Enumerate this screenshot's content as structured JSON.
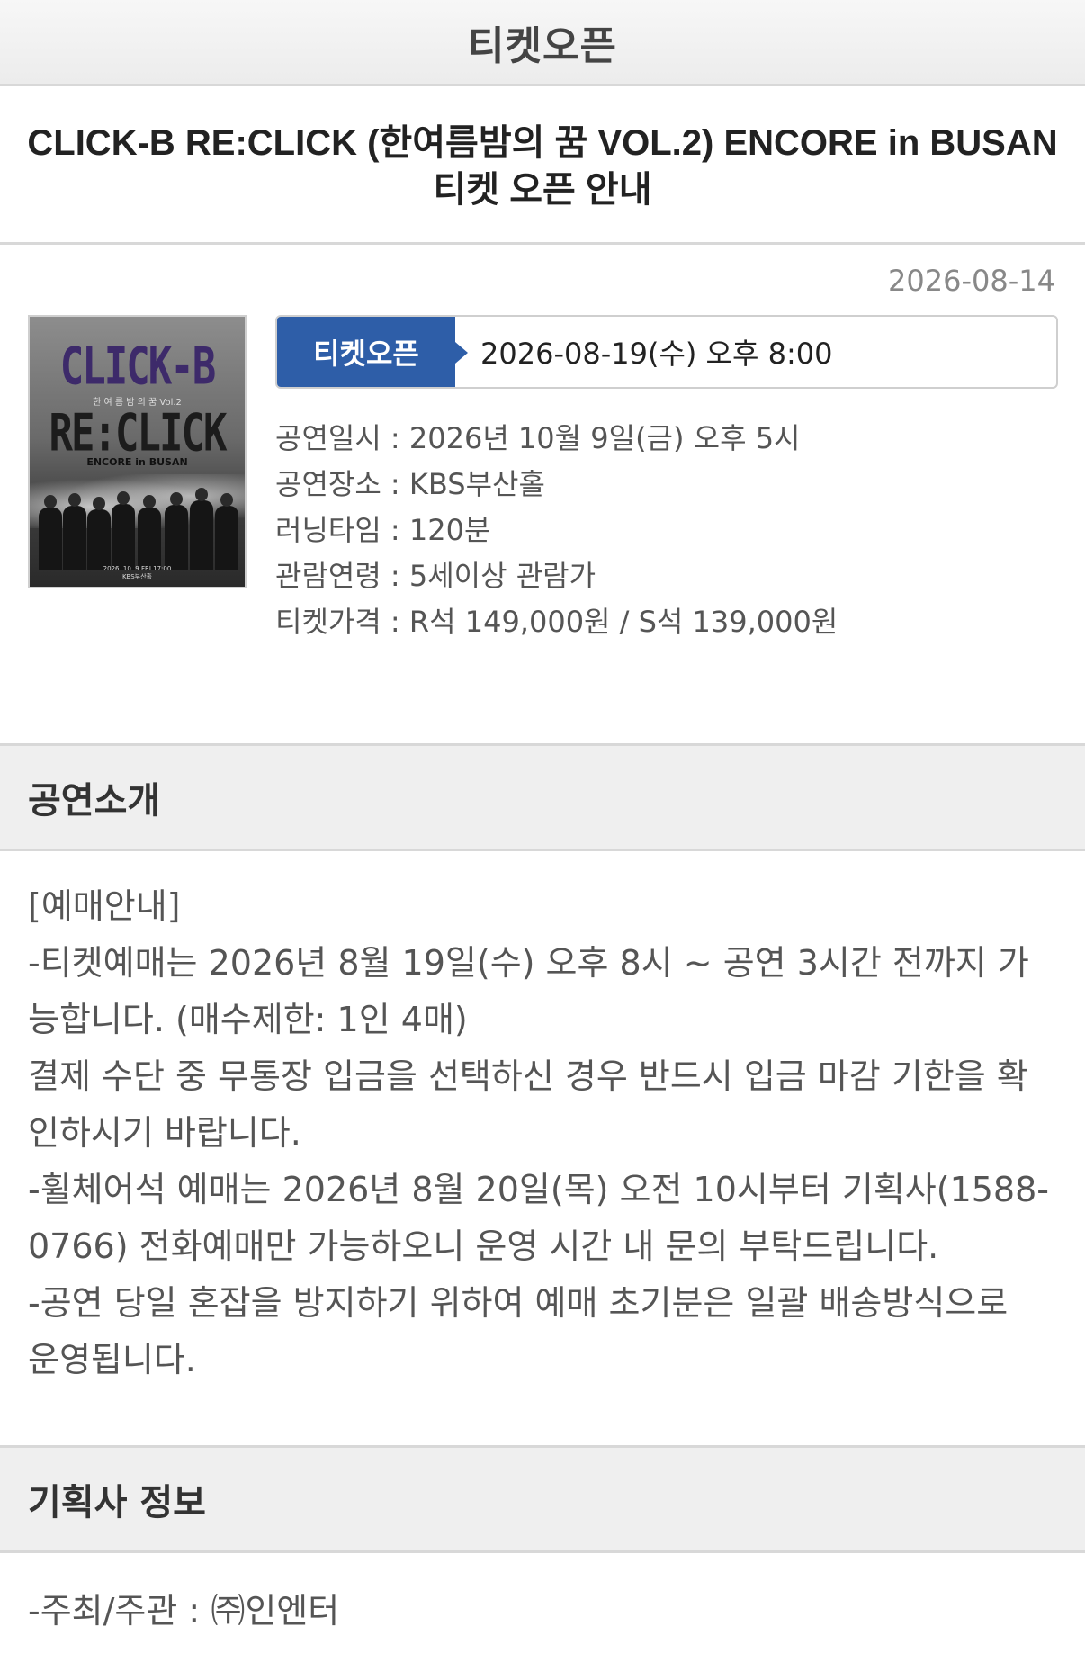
{
  "header": {
    "title": "티켓오픈"
  },
  "event": {
    "title": "CLICK-B RE:CLICK (한여름밤의 꿈 VOL.2) ENCORE in BUSAN 티켓 오픈 안내",
    "posted_date": "2026-08-14",
    "poster": {
      "logo_top": "CLICK-B",
      "subtitle": "한 여 름 밤 의 꿈 Vol.2",
      "logo_bottom": "RE:CLICK",
      "encore": "ENCORE in BUSAN",
      "date_line": "2026. 10. 9 FRI 17:00",
      "venue_line": "KBS부산홀"
    },
    "ticket_open": {
      "badge": "티켓오픈",
      "datetime": "2026-08-19(수) 오후 8:00"
    },
    "info": [
      "공연일시 : 2026년 10월 9일(금) 오후 5시",
      "공연장소 : KBS부산홀",
      "러닝타임 : 120분",
      "관람연령 : 5세이상 관람가",
      "티켓가격 : R석 149,000원 / S석 139,000원"
    ]
  },
  "sections": {
    "intro_title": "공연소개",
    "intro_lines": [
      "[예매안내]",
      "-티켓예매는 2026년 8월 19일(수) 오후 8시 ~ 공연 3시간 전까지 가",
      "능합니다. (매수제한: 1인 4매)",
      "결제 수단 중 무통장 입금을 선택하신 경우 반드시 입금 마감 기한을 확",
      "인하시기 바랍니다.",
      "-휠체어석 예매는 2026년 8월 20일(목) 오전 10시부터 기획사(1588-",
      "0766) 전화예매만 가능하오니 운영 시간 내 문의 부탁드립니다.",
      "-공연 당일 혼잡을 방지하기 위하여 예매 초기분은 일괄 배송방식으로",
      "운영됩니다."
    ],
    "promoter_title": "기획사 정보",
    "promoter_line": "-주최/주관 : ㈜인엔터"
  },
  "colors": {
    "badge": "#2e5ea8",
    "section_bg": "#efefef"
  }
}
